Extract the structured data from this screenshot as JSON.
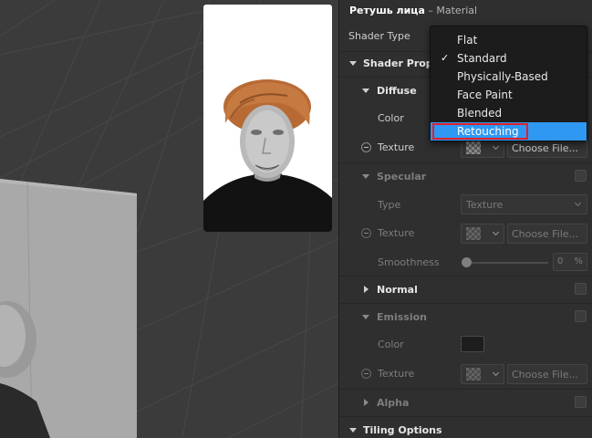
{
  "inspector": {
    "title": "Ретушь лица",
    "subtitle": "– Material",
    "shader_type_label": "Shader Type",
    "shader_properties_label": "Shader Propert",
    "diffuse": {
      "label": "Diffuse",
      "color_label": "Color",
      "texture_label": "Texture",
      "choose_file": "Choose File..."
    },
    "specular": {
      "label": "Specular",
      "type_label": "Type",
      "type_value": "Texture",
      "texture_label": "Texture",
      "choose_file": "Choose File...",
      "smoothness_label": "Smoothness",
      "smoothness_value": "0",
      "smoothness_unit": "%"
    },
    "normal_label": "Normal",
    "emission": {
      "label": "Emission",
      "color_label": "Color",
      "texture_label": "Texture",
      "choose_file": "Choose File..."
    },
    "alpha_label": "Alpha",
    "tiling_label": "Tiling Options"
  },
  "shader_menu": {
    "items": [
      "Flat",
      "Standard",
      "Physically-Based",
      "Face Paint",
      "Blended",
      "Retouching"
    ],
    "checked": "Standard",
    "highlighted": "Retouching",
    "check_glyph": "✓"
  },
  "colors": {
    "accent": "#2f98f2",
    "highlight_box": "#e0202a",
    "panel": "#2f2f2f",
    "viewport": "#3b3b3b"
  }
}
